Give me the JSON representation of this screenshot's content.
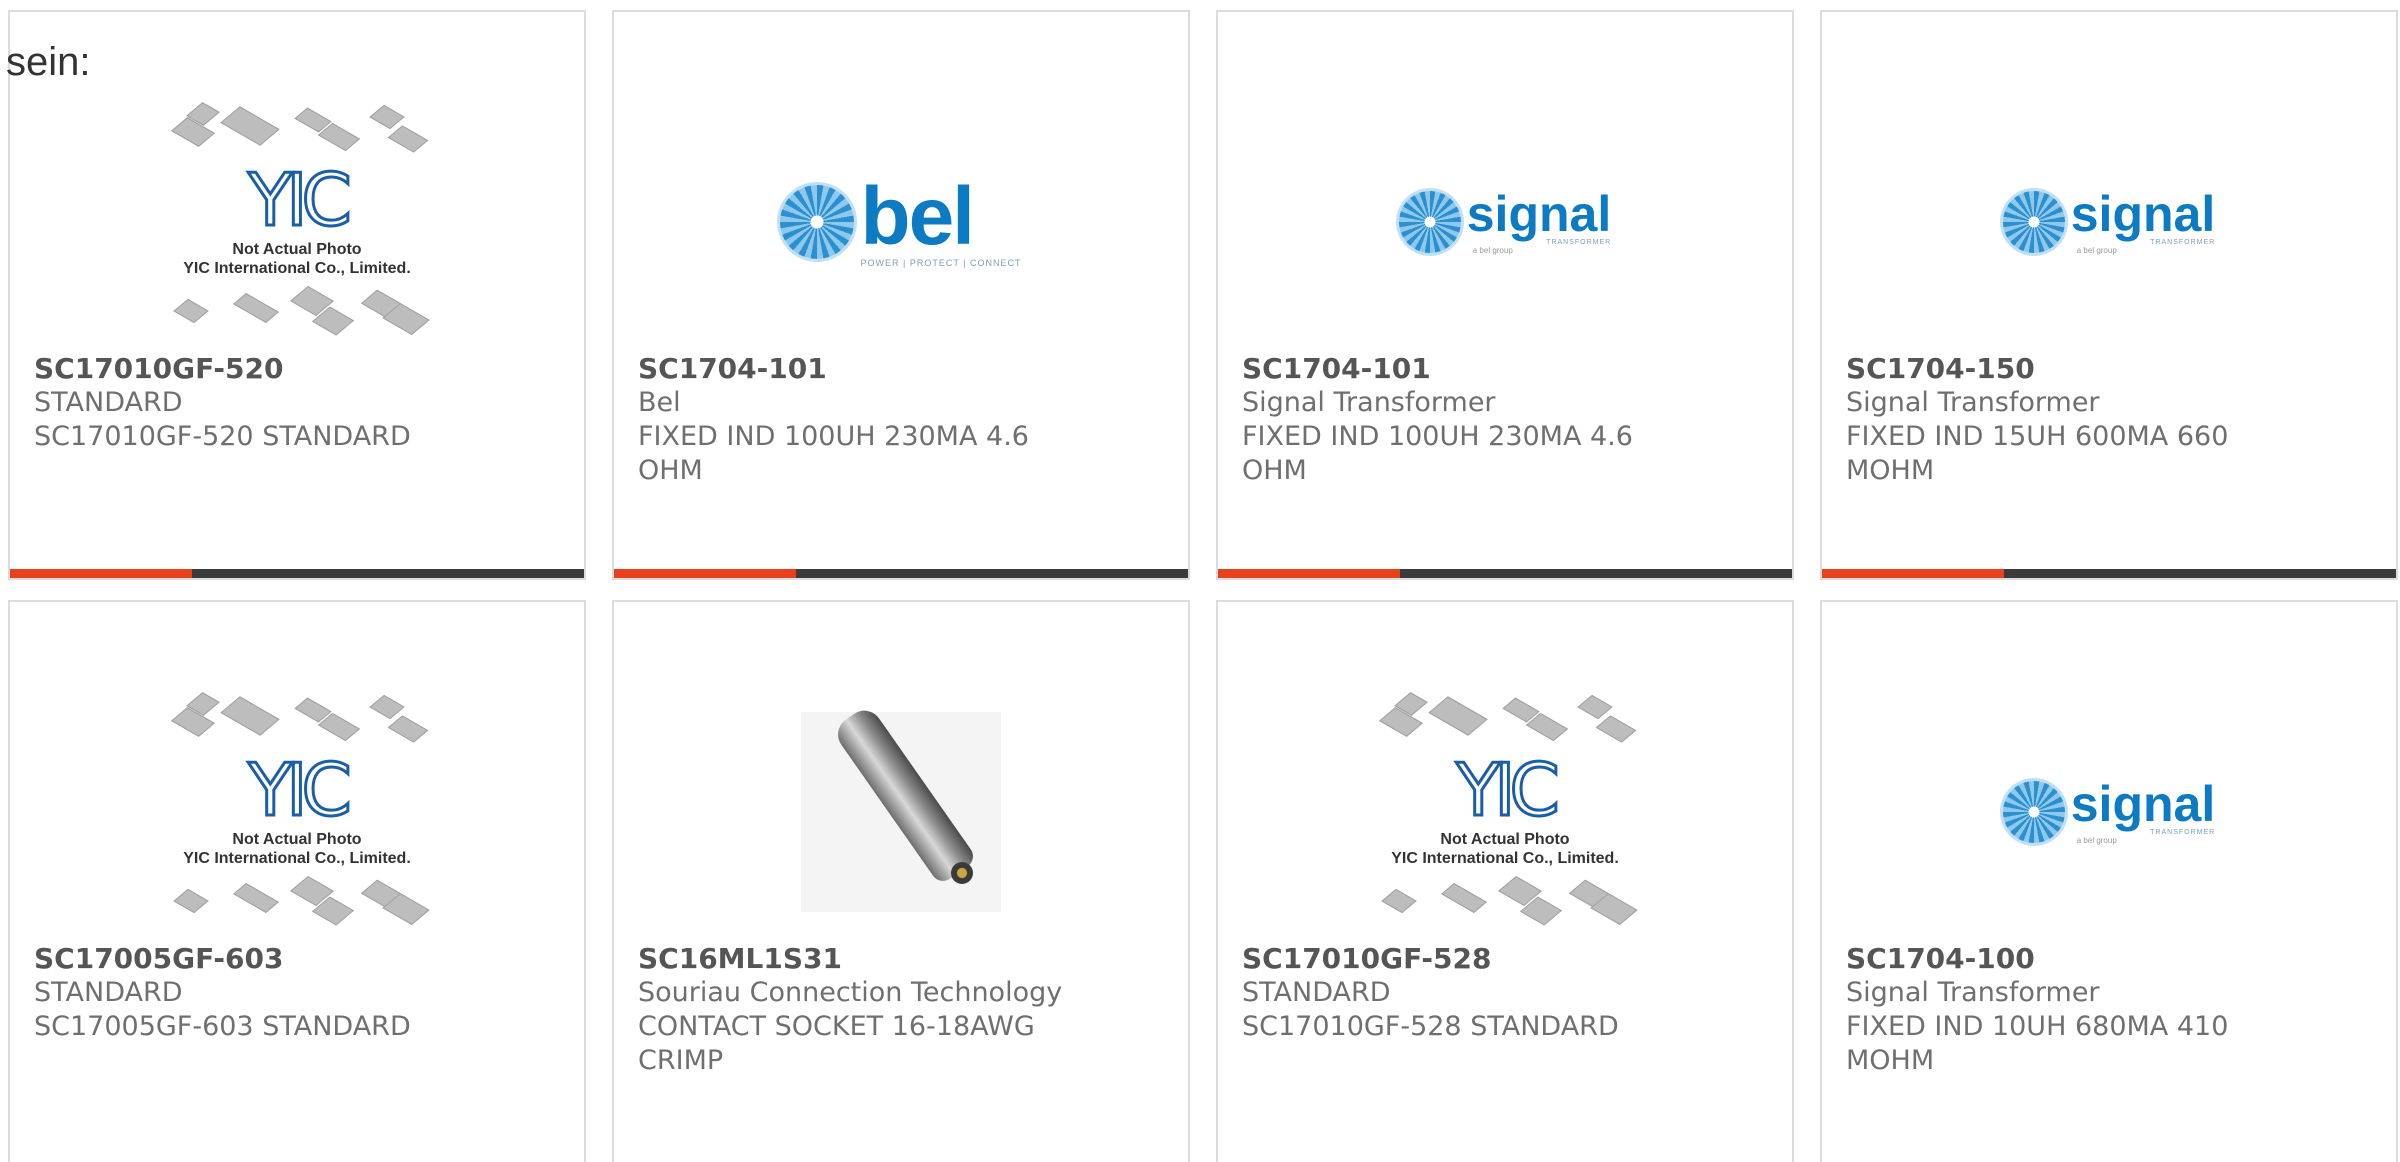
{
  "intro_text": "sein:",
  "colors": {
    "accent": "#e8421d",
    "bar": "#3b3b3b",
    "border": "#dcdcdc"
  },
  "products": [
    {
      "part_number": "SC17010GF-520",
      "manufacturer": "STANDARD",
      "description": "SC17010GF-520 STANDARD",
      "image": "yic-placeholder"
    },
    {
      "part_number": "SC1704-101",
      "manufacturer": "Bel",
      "description": "FIXED IND 100UH 230MA 4.6 OHM",
      "image": "bel-logo"
    },
    {
      "part_number": "SC1704-101",
      "manufacturer": "Signal Transformer",
      "description": "FIXED IND 100UH 230MA 4.6 OHM",
      "image": "signal-transformer-logo"
    },
    {
      "part_number": "SC1704-150",
      "manufacturer": "Signal Transformer",
      "description": "FIXED IND 15UH 600MA 660 MOHM",
      "image": "signal-transformer-logo"
    },
    {
      "part_number": "SC17005GF-603",
      "manufacturer": "STANDARD",
      "description": "SC17005GF-603 STANDARD",
      "image": "yic-placeholder"
    },
    {
      "part_number": "SC16ML1S31",
      "manufacturer": "Souriau Connection Technology",
      "description": "CONTACT SOCKET 16-18AWG CRIMP",
      "image": "contact-socket-photo"
    },
    {
      "part_number": "SC17010GF-528",
      "manufacturer": "STANDARD",
      "description": "SC17010GF-528 STANDARD",
      "image": "yic-placeholder"
    },
    {
      "part_number": "SC1704-100",
      "manufacturer": "Signal Transformer",
      "description": "FIXED IND 10UH 680MA 410 MOHM",
      "image": "signal-transformer-logo"
    }
  ],
  "images": {
    "yic": {
      "logo_text": "YIC",
      "caption_line1": "Not Actual Photo",
      "caption_line2": "YIC International Co., Limited."
    },
    "bel": {
      "name": "bel",
      "tagline": "POWER | PROTECT | CONNECT"
    },
    "signal": {
      "name": "signal",
      "tagline": "TRANSFORMER",
      "sub": "a bel group"
    }
  }
}
